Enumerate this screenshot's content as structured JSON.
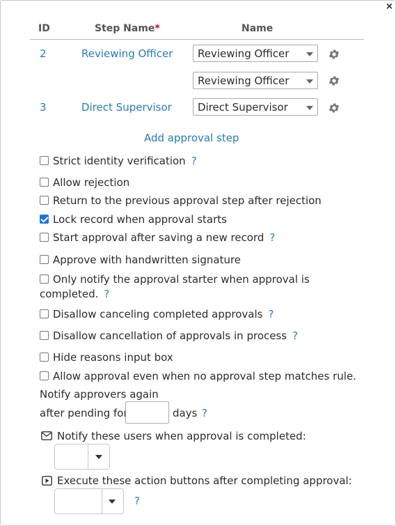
{
  "dialog": {
    "close_label": "×"
  },
  "table": {
    "headers": {
      "id": "ID",
      "step_name": "Step Name",
      "required_mark": "*",
      "name": "Name"
    },
    "rows": [
      {
        "id": "2",
        "step_name": "Reviewing Officer",
        "select_value": "Reviewing Officer"
      },
      {
        "id": "",
        "step_name": "",
        "select_value": "Reviewing Officer"
      },
      {
        "id": "3",
        "step_name": "Direct Supervisor",
        "select_value": "Direct Supervisor"
      }
    ],
    "add_step_label": "Add approval step"
  },
  "options": [
    {
      "label": "Strict identity verification",
      "checked": false,
      "help": "?"
    },
    {
      "label": "Allow rejection",
      "checked": false
    },
    {
      "label": "Return to the previous approval step after rejection",
      "checked": false
    },
    {
      "label": "Lock record when approval starts",
      "checked": true
    },
    {
      "label": "Start approval after saving a new record",
      "checked": false,
      "help": "?"
    },
    {
      "label": "Approve with handwritten signature",
      "checked": false
    },
    {
      "label_line1": "Only notify the approval starter when approval is",
      "label_line2": "completed.",
      "checked": false,
      "help": "?"
    },
    {
      "label": "Disallow canceling completed approvals",
      "checked": false,
      "help": "?"
    },
    {
      "label": "Disallow cancellation of approvals in process",
      "checked": false,
      "help": "?"
    },
    {
      "label": "Hide reasons input box",
      "checked": false
    },
    {
      "label": "Allow approval even when no approval step matches rule.",
      "checked": false
    }
  ],
  "notify_again": {
    "line1": "Notify approvers again",
    "prefix": "after pending for",
    "value": "",
    "suffix": "days",
    "help": "?"
  },
  "notify_users": {
    "label": "Notify these users when approval is completed:"
  },
  "execute_actions": {
    "label": "Execute these action buttons after completing approval:",
    "help": "?"
  }
}
